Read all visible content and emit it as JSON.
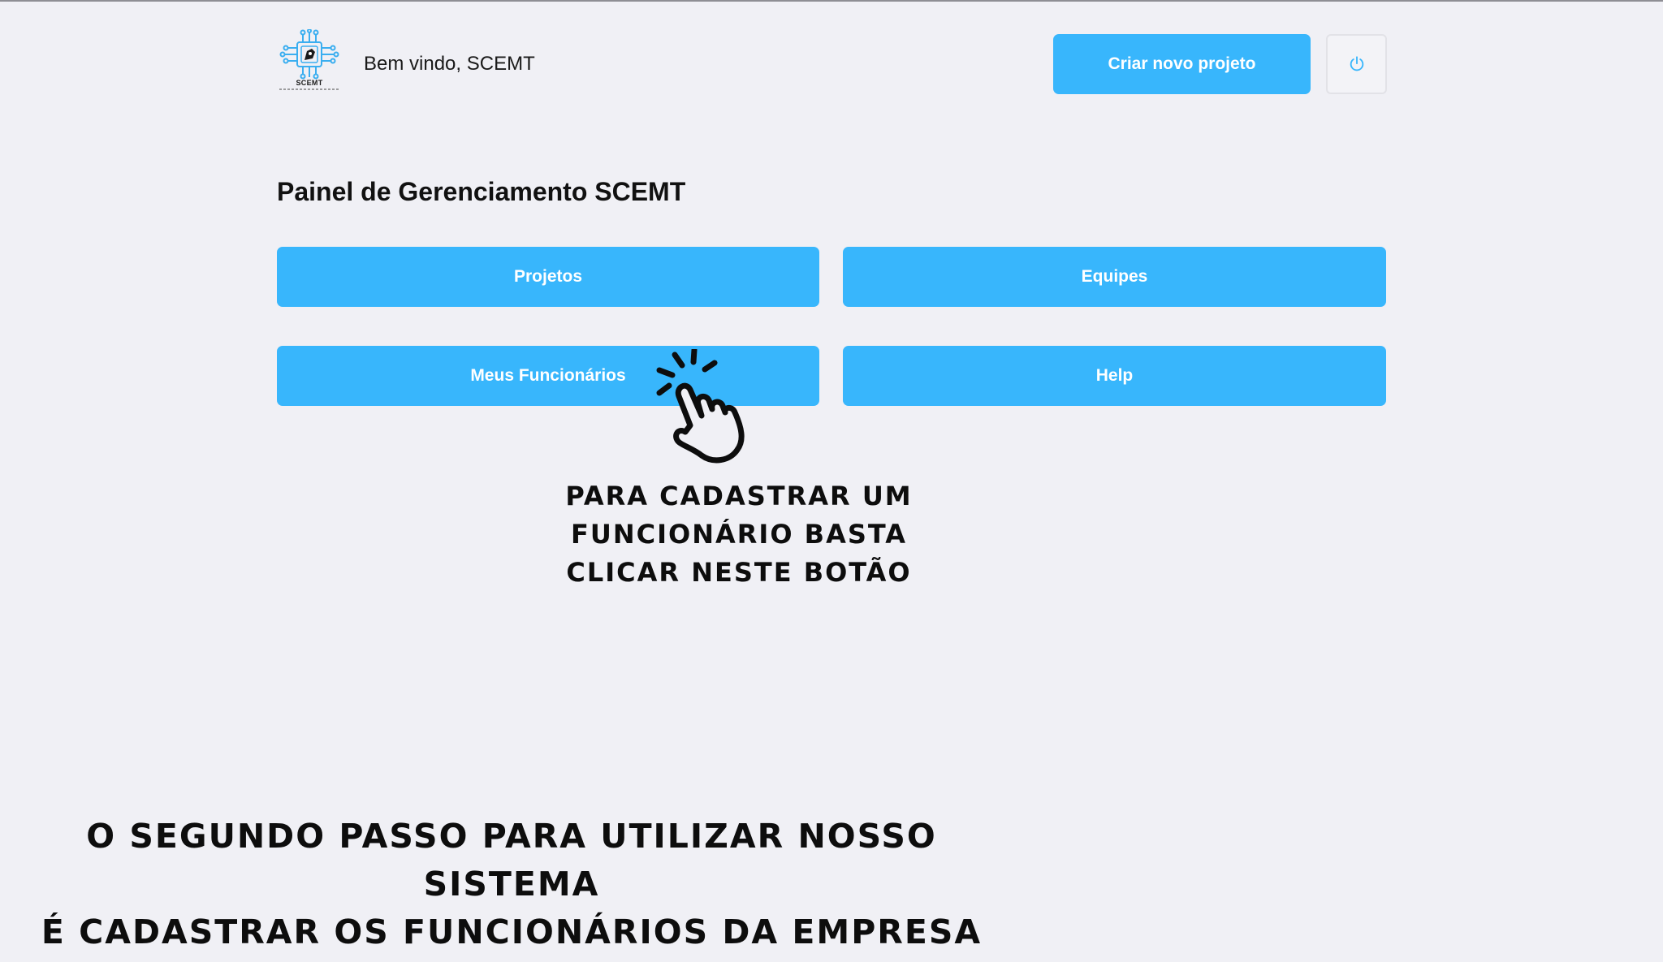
{
  "header": {
    "logo_text": "SCEMT",
    "welcome": "Bem vindo, SCEMT",
    "new_project_label": "Criar novo projeto",
    "power_icon": "power-icon"
  },
  "panel": {
    "title": "Painel de Gerenciamento SCEMT",
    "buttons": [
      {
        "label": "Projetos"
      },
      {
        "label": "Equipes"
      },
      {
        "label": "Meus Funcionários"
      },
      {
        "label": "Help"
      }
    ]
  },
  "annotation": {
    "icon": "pointing-hand-icon",
    "callout_lines": [
      "PARA CADASTRAR UM",
      "FUNCIONÁRIO BASTA",
      "CLICAR NESTE BOTÃO"
    ],
    "footer_lines": [
      "O SEGUNDO PASSO PARA UTILIZAR NOSSO SISTEMA",
      "É CADASTRAR OS FUNCIONÁRIOS DA EMPRESA"
    ]
  },
  "colors": {
    "accent": "#38b6fc",
    "background": "#f0f0f5",
    "text": "#111111"
  }
}
